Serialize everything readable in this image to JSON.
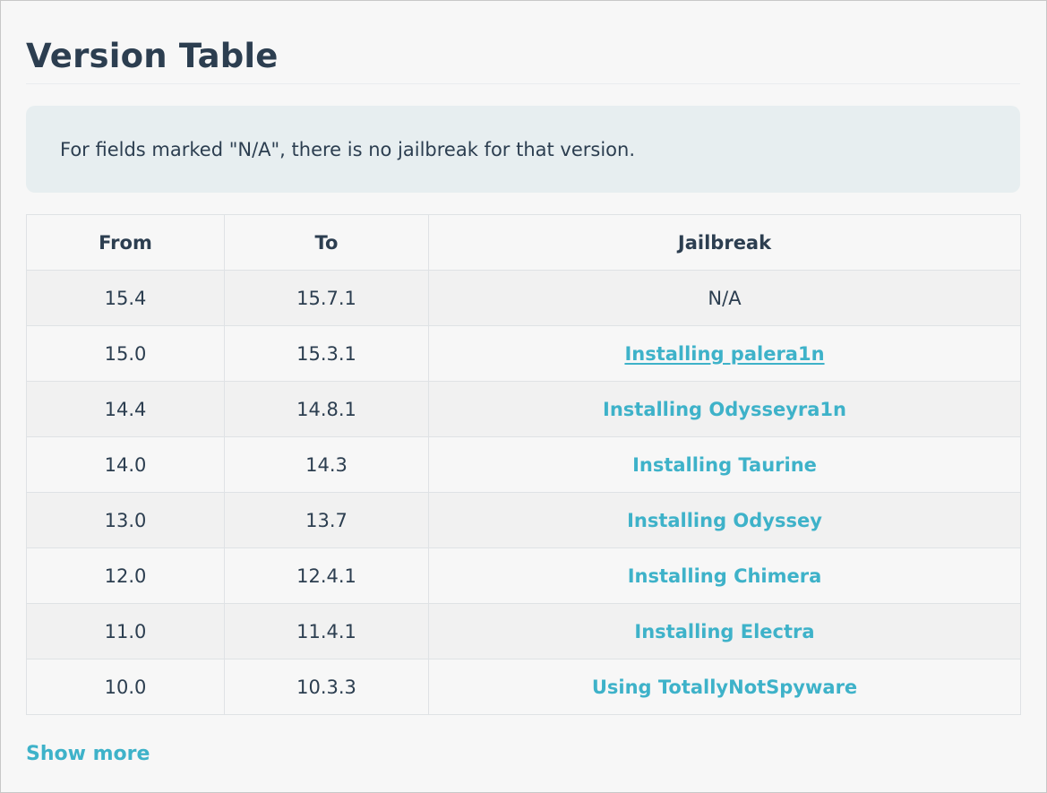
{
  "page": {
    "title": "Version Table",
    "note": "For fields marked \"N/A\", there is no jailbreak for that version."
  },
  "table": {
    "headers": [
      "From",
      "To",
      "Jailbreak"
    ],
    "rows": [
      {
        "from": "15.4",
        "to": "15.7.1",
        "jailbreak": "N/A",
        "is_link": false,
        "underlined": false
      },
      {
        "from": "15.0",
        "to": "15.3.1",
        "jailbreak": "Installing palera1n",
        "is_link": true,
        "underlined": true
      },
      {
        "from": "14.4",
        "to": "14.8.1",
        "jailbreak": "Installing Odysseyra1n",
        "is_link": true,
        "underlined": false
      },
      {
        "from": "14.0",
        "to": "14.3",
        "jailbreak": "Installing Taurine",
        "is_link": true,
        "underlined": false
      },
      {
        "from": "13.0",
        "to": "13.7",
        "jailbreak": "Installing Odyssey",
        "is_link": true,
        "underlined": false
      },
      {
        "from": "12.0",
        "to": "12.4.1",
        "jailbreak": "Installing Chimera",
        "is_link": true,
        "underlined": false
      },
      {
        "from": "11.0",
        "to": "11.4.1",
        "jailbreak": "Installing Electra",
        "is_link": true,
        "underlined": false
      },
      {
        "from": "10.0",
        "to": "10.3.3",
        "jailbreak": "Using TotallyNotSpyware",
        "is_link": true,
        "underlined": false
      }
    ]
  },
  "footer": {
    "show_more_label": "Show more"
  },
  "colors": {
    "text": "#2c3e50",
    "link": "#3eb2c9",
    "note_background": "#e7eef0",
    "page_background": "#f7f7f7",
    "row_stripe": "#f1f1f1"
  }
}
